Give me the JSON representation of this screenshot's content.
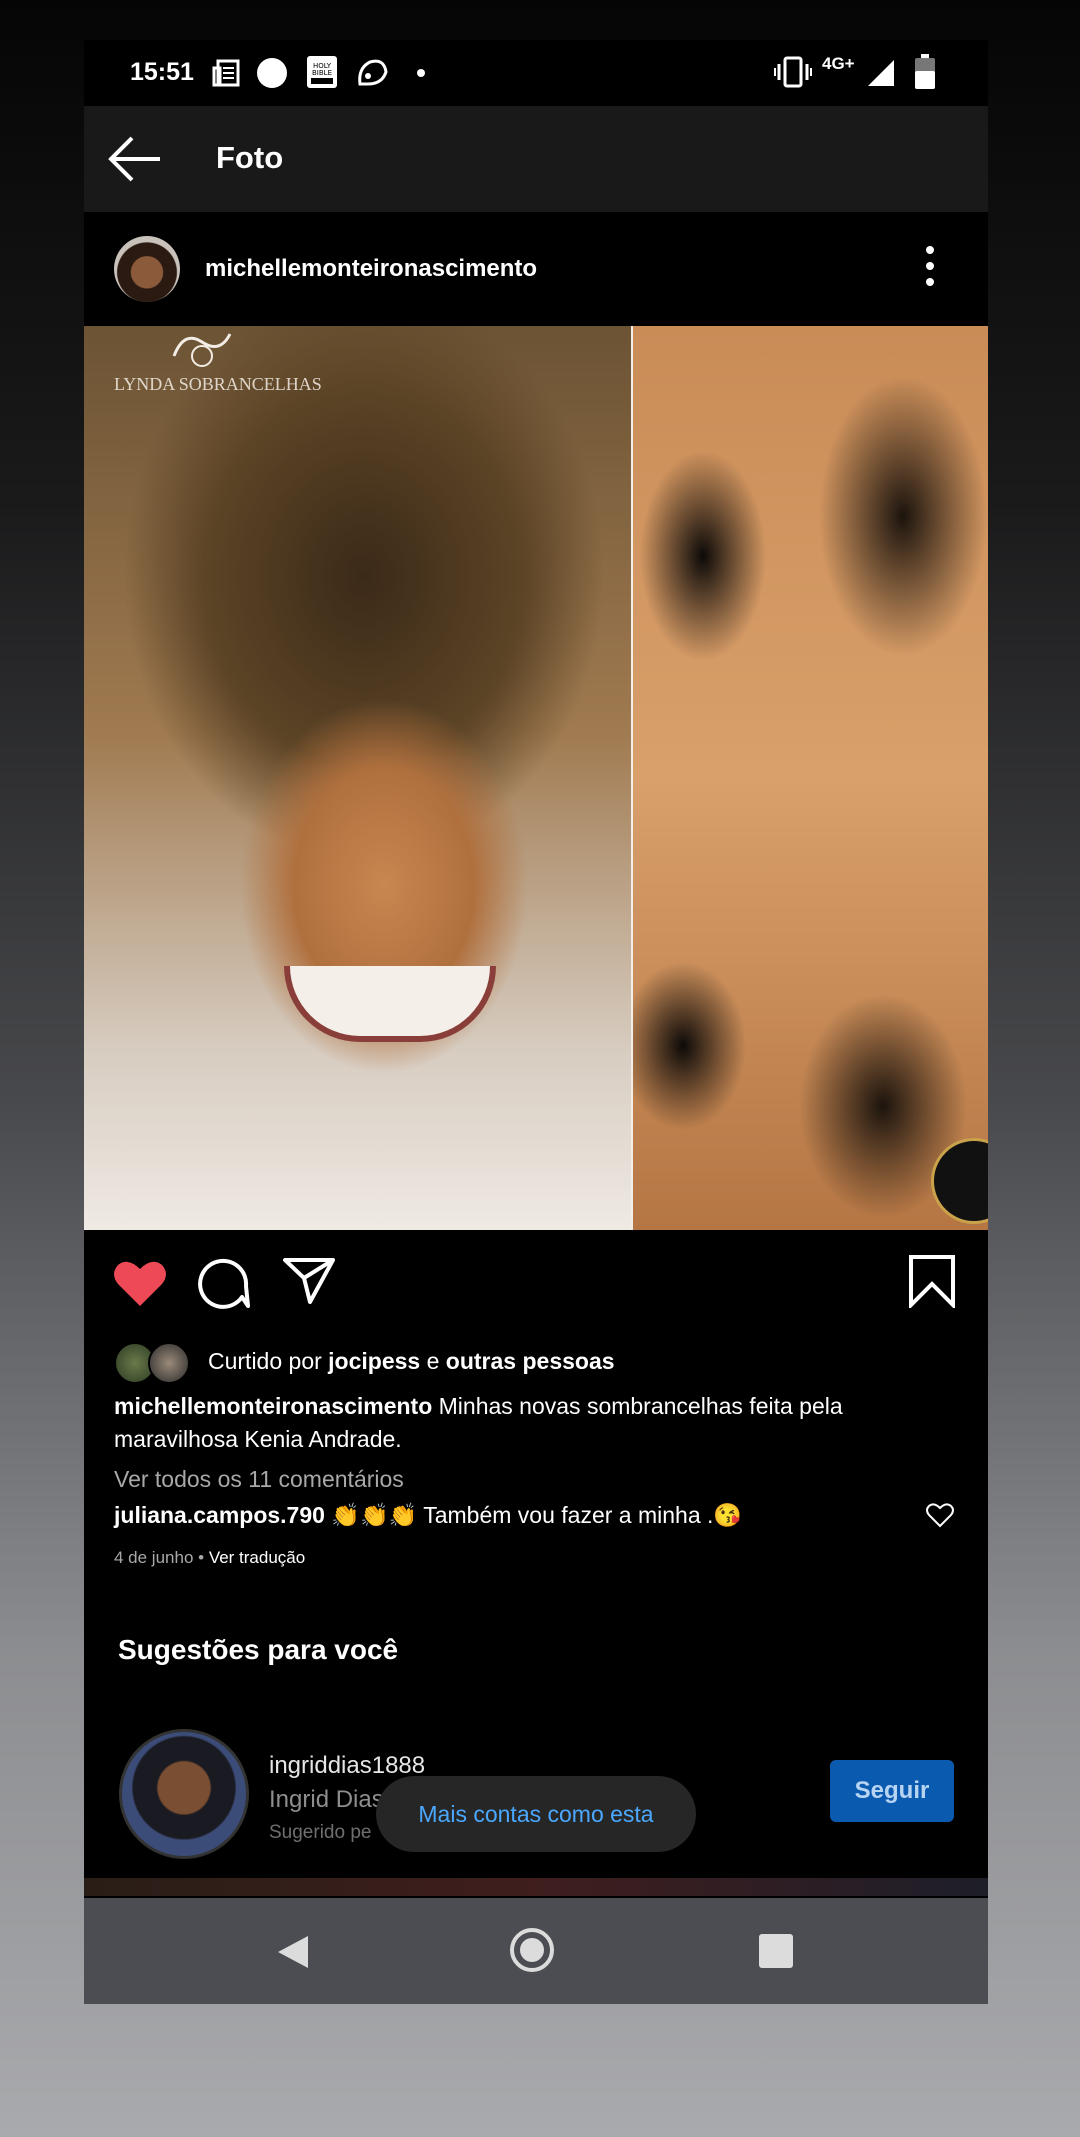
{
  "status_bar": {
    "time": "15:51",
    "network": "4G+",
    "icons": [
      "news-icon",
      "circle-icon",
      "bible-icon",
      "cat-icon",
      "dot-icon",
      "vibrate-icon",
      "signal-icon",
      "battery-icon"
    ]
  },
  "app_bar": {
    "title": "Foto"
  },
  "post": {
    "username": "michellemonteironascimento",
    "image_watermark": "LYNDA SOBRANCELHAS",
    "liked": true,
    "likes_prefix": "Curtido por ",
    "likes_user": "jocipess",
    "likes_joiner": " e ",
    "likes_others": "outras pessoas",
    "caption_user": "michellemonteironascimento",
    "caption_text": " Minhas novas sombrancelhas feita pela maravilhosa Kenia Andrade.",
    "view_comments": "Ver todos os 11 comentários",
    "comment_user": "juliana.campos.790",
    "comment_text": " 👏👏👏 Também vou fazer a minha .😘",
    "date": "4 de junho",
    "separator": " • ",
    "translate": "Ver tradução"
  },
  "suggestions": {
    "title": "Sugestões para você",
    "card": {
      "username": "ingriddias1888",
      "name": "Ingrid Dias",
      "reason": "Sugerido pe",
      "follow_label": "Seguir"
    },
    "toast": "Mais contas como esta"
  },
  "colors": {
    "like_red": "#ed4956",
    "link_blue": "#4aa8ff",
    "follow_blue": "#0a5bb0"
  }
}
